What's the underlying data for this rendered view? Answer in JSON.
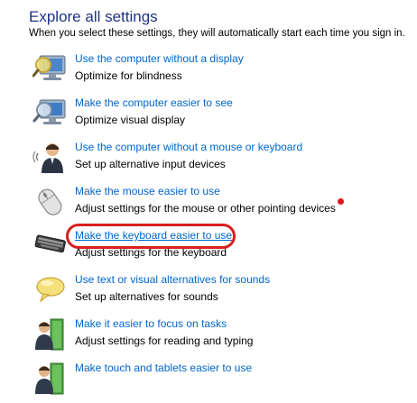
{
  "header": {
    "title": "Explore all settings",
    "subtitle": "When you select these settings, they will automatically start each time you sign in."
  },
  "items": [
    {
      "link": "Use the computer without a display",
      "description": "Optimize for blindness",
      "icon": "monitor-magnifier-icon"
    },
    {
      "link": "Make the computer easier to see",
      "description": "Optimize visual display",
      "icon": "monitor-magnifier-icon"
    },
    {
      "link": "Use the computer without a mouse or keyboard",
      "description": "Set up alternative input devices",
      "icon": "person-speaking-icon"
    },
    {
      "link": "Make the mouse easier to use",
      "description": "Adjust settings for the mouse or other pointing devices",
      "icon": "mouse-icon"
    },
    {
      "link": "Make the keyboard easier to use",
      "description": "Adjust settings for the keyboard",
      "icon": "keyboard-icon"
    },
    {
      "link": "Use text or visual alternatives for sounds",
      "description": "Set up alternatives for sounds",
      "icon": "speech-bubble-icon"
    },
    {
      "link": "Make it easier to focus on tasks",
      "description": "Adjust settings for reading and typing",
      "icon": "person-book-icon"
    },
    {
      "link": "Make touch and tablets easier to use",
      "description": "",
      "icon": "person-book-icon"
    }
  ],
  "colors": {
    "title": "#1e3287",
    "link": "#0066cc",
    "annotation": "#d81e1e"
  }
}
